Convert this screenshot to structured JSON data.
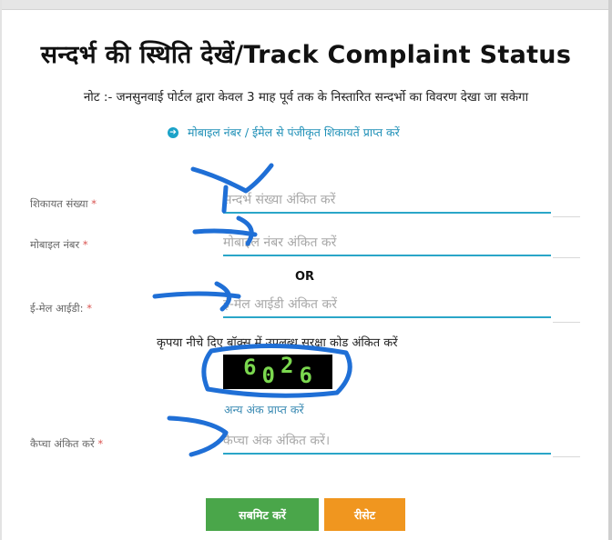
{
  "title": "सन्दर्भ की स्थिति देखें/Track Complaint Status",
  "note": "नोट :- जनसुनवाई पोर्टल द्वारा केवल 3 माह पूर्व तक के निस्तारित सन्दर्भो का विवरण देखा जा सकेगा",
  "registered_link": "मोबाइल नंबर / ईमेल से पंजीकृत शिकायतें प्राप्त करें",
  "fields": {
    "complaint_no": {
      "label": "शिकायत संख्या",
      "placeholder": "सन्दर्भ संख्या अंकित करें"
    },
    "mobile": {
      "label": "मोबाइल नंबर",
      "placeholder": "मोबाइल नंबर अंकित करें"
    },
    "email": {
      "label": "ई-मेल आईडी:",
      "placeholder": "ई-मेल आईडी अंकित करें"
    },
    "captcha": {
      "label": "कैप्चा अंकित करें",
      "placeholder": "कैप्चा अंक अंकित करें।"
    }
  },
  "required_mark": "*",
  "or_text": "OR",
  "captcha": {
    "instruction": "कृपया नीचे दिए बॉक्स में उपलब्ध सुरक्षा कोड अंकित करें",
    "digits": [
      "6",
      "0",
      "2",
      "6"
    ],
    "refresh_link": "अन्य अंक प्राप्त करें"
  },
  "buttons": {
    "submit": "सबमिट करें",
    "reset": "रीसेट"
  },
  "colors": {
    "accent": "#2aa6c8",
    "submit": "#4aa64a",
    "reset": "#f0961f",
    "annotation": "#1f6fd6"
  }
}
